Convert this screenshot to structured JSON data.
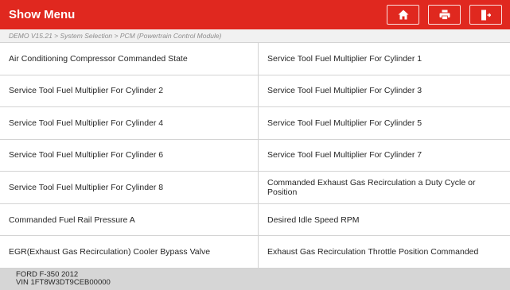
{
  "header": {
    "title": "Show Menu",
    "accent_color": "#e0281f",
    "buttons": [
      {
        "icon": "home-icon"
      },
      {
        "icon": "printer-icon"
      },
      {
        "icon": "exit-icon"
      }
    ]
  },
  "breadcrumb": "DEMO V15.21 > System Selection > PCM (Powertrain Control Module)",
  "items": [
    "Air Conditioning Compressor Commanded State",
    "Service Tool Fuel Multiplier For Cylinder 1",
    "Service Tool Fuel Multiplier For Cylinder 2",
    "Service Tool Fuel Multiplier For Cylinder 3",
    "Service Tool Fuel Multiplier For Cylinder 4",
    "Service Tool Fuel Multiplier For Cylinder 5",
    "Service Tool Fuel Multiplier For Cylinder 6",
    "Service Tool Fuel Multiplier For Cylinder 7",
    "Service Tool Fuel Multiplier For Cylinder 8",
    "Commanded Exhaust Gas Recirculation a Duty Cycle or Position",
    "Commanded Fuel Rail Pressure A",
    "Desired Idle Speed RPM",
    "EGR(Exhaust Gas Recirculation) Cooler Bypass Valve",
    "Exhaust Gas Recirculation Throttle Position Commanded"
  ],
  "footer": {
    "vehicle": "FORD F-350 2012",
    "vin": "VIN 1FT8W3DT9CEB00000"
  }
}
